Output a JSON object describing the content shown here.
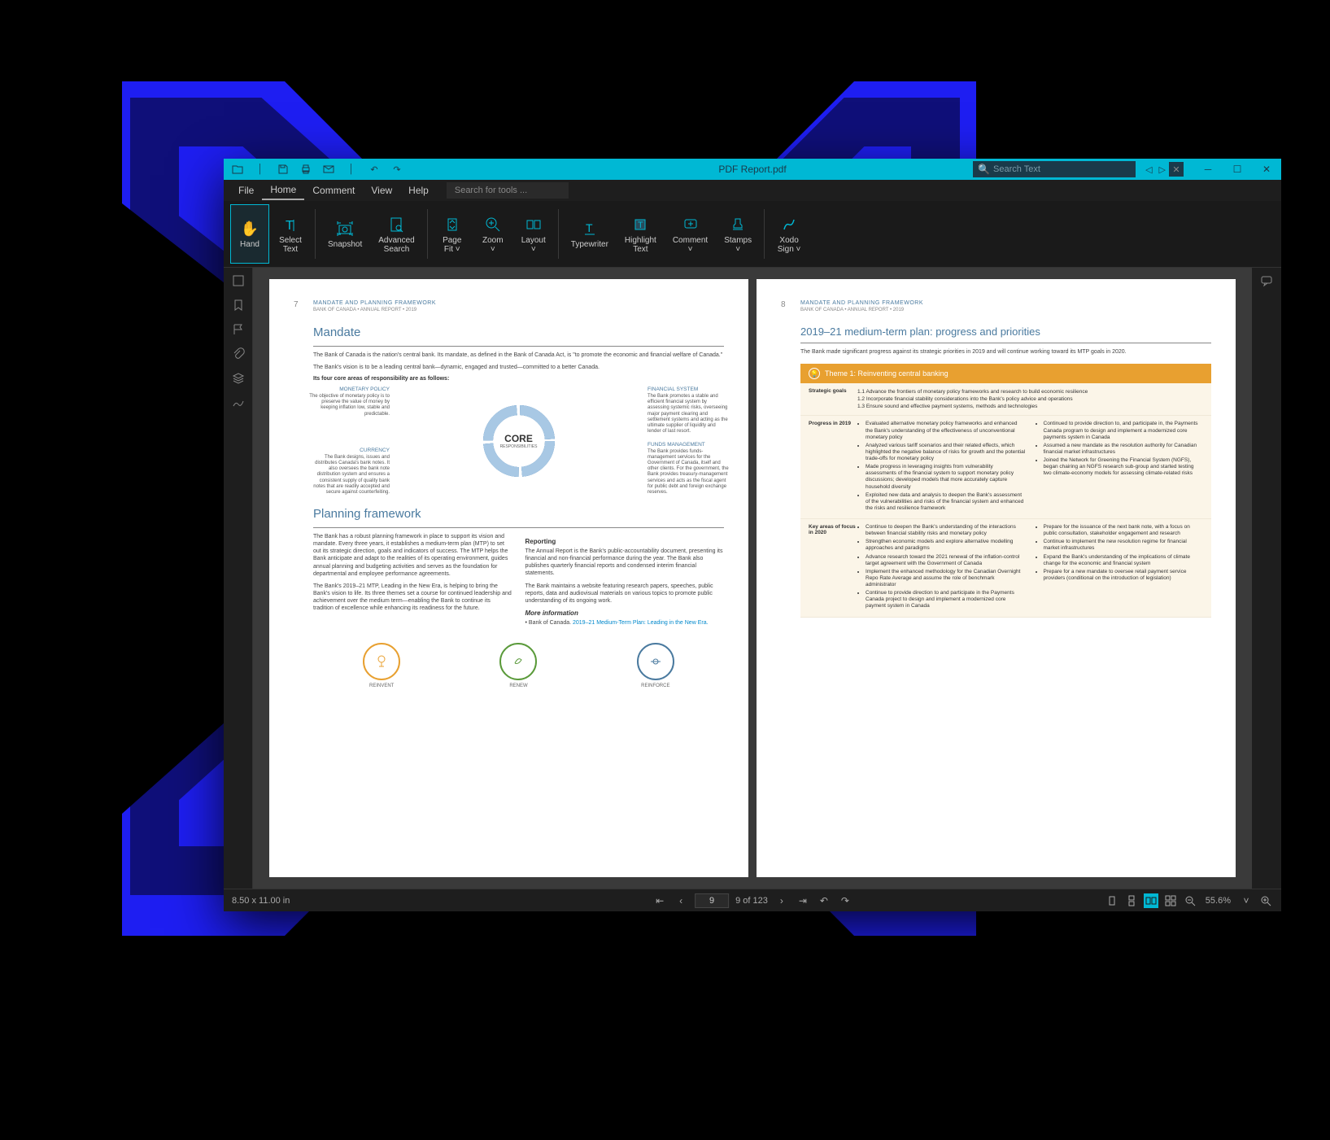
{
  "titlebar": {
    "title": "PDF Report.pdf",
    "search_placeholder": "Search Text"
  },
  "menu": {
    "items": [
      "File",
      "Home",
      "Comment",
      "View",
      "Help"
    ],
    "tool_search_placeholder": "Search for tools ..."
  },
  "ribbon": {
    "hand": "Hand",
    "select_text": "Select\nText",
    "snapshot": "Snapshot",
    "adv_search": "Advanced\nSearch",
    "page_fit": "Page\nFit",
    "zoom": "Zoom",
    "layout": "Layout",
    "typewriter": "Typewriter",
    "highlight": "Highlight\nText",
    "comment": "Comment",
    "stamps": "Stamps",
    "xodo_sign": "Xodo\nSign"
  },
  "page_left": {
    "num": "7",
    "header": "MANDATE AND PLANNING FRAMEWORK",
    "subheader": "BANK OF CANADA  •  ANNUAL REPORT  •  2019",
    "h1": "Mandate",
    "p1": "The Bank of Canada is the nation's central bank. Its mandate, as defined in the Bank of Canada Act, is \"to promote the economic and financial welfare of Canada.\"",
    "p2": "The Bank's vision is to be a leading central bank—dynamic, engaged and trusted—committed to a better Canada.",
    "p3": "Its four core areas of responsibility are as follows:",
    "core": {
      "center": "CORE",
      "center_sub": "RESPONSIBILITIES",
      "mp_title": "MONETARY POLICY",
      "mp_text": "The objective of monetary policy is to preserve the value of money by keeping inflation low, stable and predictable.",
      "fs_title": "FINANCIAL SYSTEM",
      "fs_text": "The Bank promotes a stable and efficient financial system by assessing systemic risks, overseeing major payment clearing and settlement systems and acting as the ultimate supplier of liquidity and lender of last resort.",
      "cur_title": "CURRENCY",
      "cur_text": "The Bank designs, issues and distributes Canada's bank notes. It also oversees the bank note distribution system and ensures a consistent supply of quality bank notes that are readily accepted and secure against counterfeiting.",
      "fm_title": "FUNDS MANAGEMENT",
      "fm_text": "The Bank provides funds-management services for the Government of Canada, itself and other clients. For the government, the Bank provides treasury-management services and acts as the fiscal agent for public debt and foreign exchange reserves."
    },
    "h2": "Planning framework",
    "pf1": "The Bank has a robust planning framework in place to support its vision and mandate. Every three years, it establishes a medium-term plan (MTP) to set out its strategic direction, goals and indicators of success. The MTP helps the Bank anticipate and adapt to the realities of its operating environment, guides annual planning and budgeting activities and serves as the foundation for departmental and employee performance agreements.",
    "pf2": "The Bank's 2019–21 MTP, Leading in the New Era, is helping to bring the Bank's vision to life. Its three themes set a course for continued leadership and achievement over the medium term—enabling the Bank to continue its tradition of excellence while enhancing its readiness for the future.",
    "reporting_h": "Reporting",
    "rep1": "The Annual Report is the Bank's public-accountability document, presenting its financial and non-financial performance during the year. The Bank also publishes quarterly financial reports and condensed interim financial statements.",
    "rep2": "The Bank maintains a website featuring research papers, speeches, public reports, data and audiovisual materials on various topics to promote public understanding of its ongoing work.",
    "more_h": "More information",
    "more_bullet": "Bank of Canada. ",
    "more_link": "2019–21 Medium-Term Plan: Leading in the New Era.",
    "icons": {
      "reinvent": "REINVENT",
      "renew": "RENEW",
      "reinforce": "REINFORCE"
    }
  },
  "page_right": {
    "num": "8",
    "header": "MANDATE AND PLANNING FRAMEWORK",
    "subheader": "BANK OF CANADA  •  ANNUAL REPORT  •  2019",
    "h1": "2019–21 medium-term plan: progress and priorities",
    "intro": "The Bank made significant progress against its strategic priorities in 2019 and will continue working toward its MTP goals in 2020.",
    "theme": "Theme 1: Reinventing central banking",
    "goals_label": "Strategic goals",
    "goals_1": "1.1 Advance the frontiers of monetary policy frameworks and research to build economic resilience",
    "goals_2": "1.2 Incorporate financial stability considerations into the Bank's policy advice and operations",
    "goals_3": "1.3 Ensure sound and effective payment systems, methods and technologies",
    "prog_label": "Progress in 2019",
    "prog_l": [
      "Evaluated alternative monetary policy frameworks and enhanced the Bank's understanding of the effectiveness of unconventional monetary policy",
      "Analyzed various tariff scenarios and their related effects, which highlighted the negative balance of risks for growth and the potential trade-offs for monetary policy",
      "Made progress in leveraging insights from vulnerability assessments of the financial system to support monetary policy discussions; developed models that more accurately capture household diversity",
      "Exploited new data and analysis to deepen the Bank's assessment of the vulnerabilities and risks of the financial system and enhanced the risks and resilience framework"
    ],
    "prog_r": [
      "Continued to provide direction to, and participate in, the Payments Canada program to design and implement a modernized core payments system in Canada",
      "Assumed a new mandate as the resolution authority for Canadian financial market infrastructures",
      "Joined the Network for Greening the Financial System (NGFS), began chairing an NGFS research sub-group and started testing two climate-economy models for assessing climate-related risks"
    ],
    "focus_label": "Key areas of focus in 2020",
    "focus_l": [
      "Continue to deepen the Bank's understanding of the interactions between financial stability risks and monetary policy",
      "Strengthen economic models and explore alternative modelling approaches and paradigms",
      "Advance research toward the 2021 renewal of the inflation-control target agreement with the Government of Canada",
      "Implement the enhanced methodology for the Canadian Overnight Repo Rate Average and assume the role of benchmark administrator",
      "Continue to provide direction to and participate in the Payments Canada project to design and implement a modernized core payment system in Canada"
    ],
    "focus_r": [
      "Prepare for the issuance of the next bank note, with a focus on public consultation, stakeholder engagement and research",
      "Continue to implement the new resolution regime for financial market infrastructures",
      "Expand the Bank's understanding of the implications of climate change for the economic and financial system",
      "Prepare for a new mandate to oversee retail payment service providers (conditional on the introduction of legislation)"
    ]
  },
  "status": {
    "dimensions": "8.50 x 11.00 in",
    "current_page": "9",
    "page_of": "9 of 123",
    "zoom": "55.6%"
  }
}
